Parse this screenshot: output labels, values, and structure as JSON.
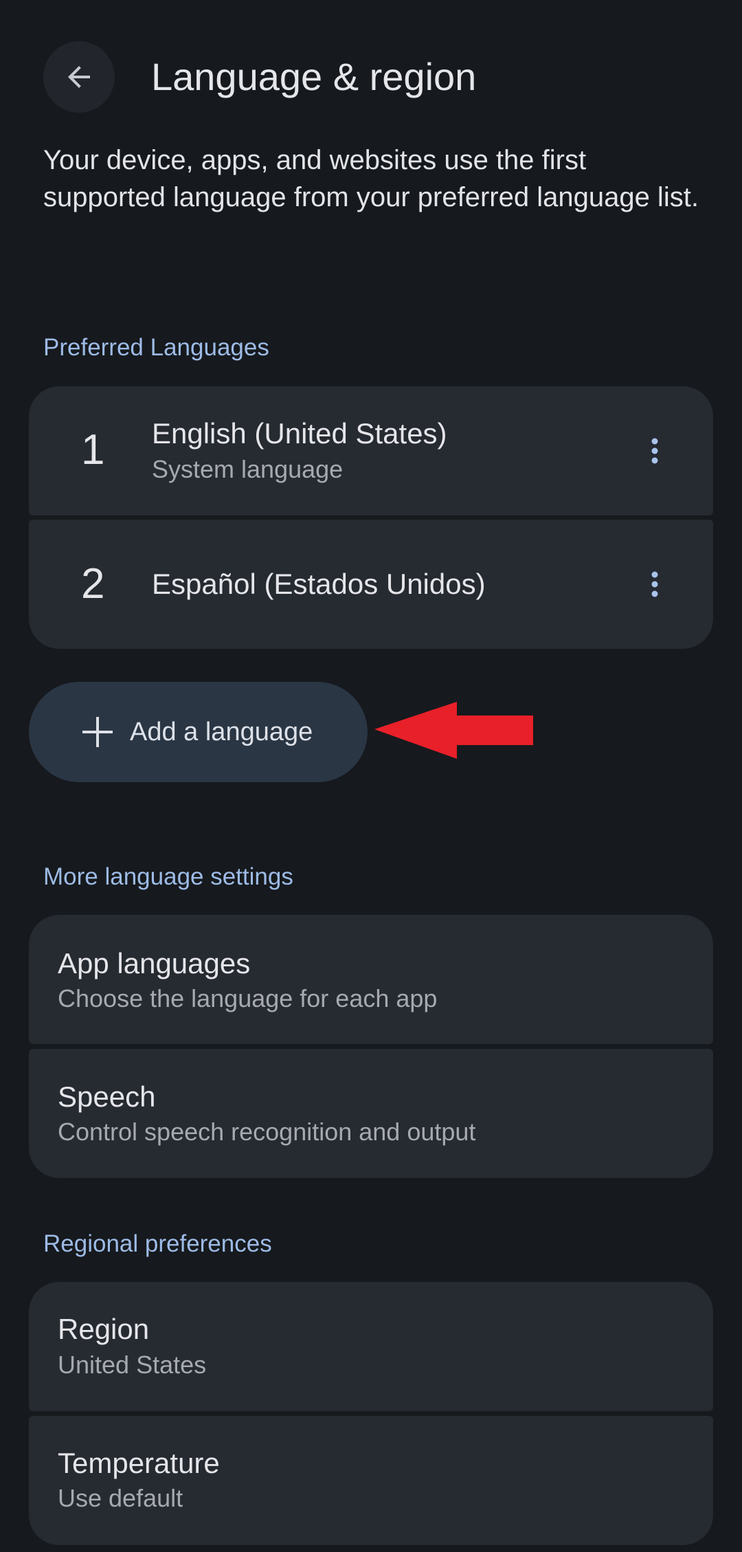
{
  "header": {
    "title": "Language & region",
    "back_icon": "arrow-back-icon"
  },
  "description": "Your device, apps, and websites use the first supported language from your preferred language list.",
  "preferred_languages": {
    "label": "Preferred Languages",
    "items": [
      {
        "number": "1",
        "title": "English (United States)",
        "subtitle": "System language"
      },
      {
        "number": "2",
        "title": "Español (Estados Unidos)",
        "subtitle": ""
      }
    ],
    "add_button_label": "Add a language"
  },
  "more_language_settings": {
    "label": "More language settings",
    "items": [
      {
        "title": "App languages",
        "subtitle": "Choose the language for each app"
      },
      {
        "title": "Speech",
        "subtitle": "Control speech recognition and output"
      }
    ]
  },
  "regional_preferences": {
    "label": "Regional preferences",
    "items": [
      {
        "title": "Region",
        "subtitle": "United States"
      },
      {
        "title": "Temperature",
        "subtitle": "Use default"
      }
    ]
  },
  "colors": {
    "background": "#16191d",
    "card": "#262a31",
    "accent": "#9dbbe6",
    "add_button": "#2a3644",
    "annotation_arrow": "#e8202a"
  }
}
